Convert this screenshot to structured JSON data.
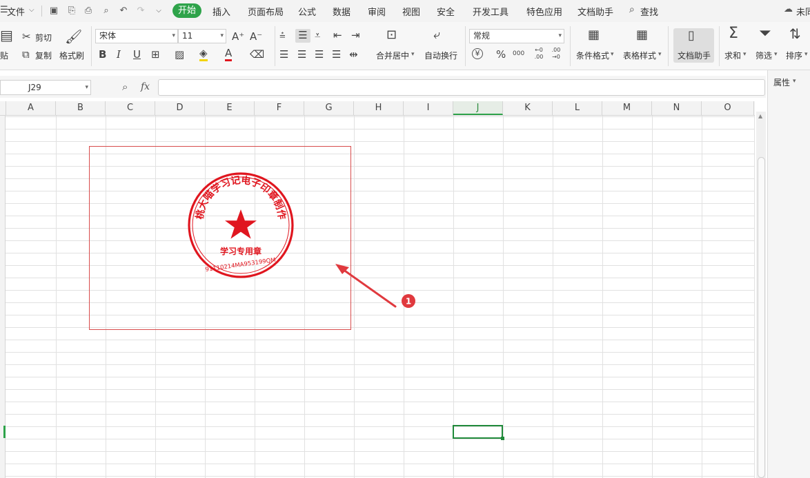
{
  "menu": {
    "file": "文件",
    "tabs": [
      "开始",
      "插入",
      "页面布局",
      "公式",
      "数据",
      "审阅",
      "视图",
      "安全",
      "开发工具",
      "特色应用",
      "文档助手"
    ],
    "search": "查找",
    "cloud": "未同"
  },
  "ribbon": {
    "paste": "贴",
    "cut": "剪切",
    "copy": "复制",
    "format_painter": "格式刷",
    "font_name": "宋体",
    "font_size": "11",
    "grow_font": "A⁺",
    "shrink_font": "A⁻",
    "merge_center": "合并居中",
    "wrap_text": "自动换行",
    "number_format": "常规",
    "currency": "¥",
    "percent": "%",
    "thousands": "000",
    "inc_decimal": "←0 .00",
    "dec_decimal": ".00 →0",
    "cond_format": "条件格式",
    "table_style": "表格样式",
    "doc_helper": "文档助手",
    "sum": "求和",
    "filter": "筛选",
    "sort": "排序"
  },
  "formula_bar": {
    "name_box": "J29",
    "fx": "fx",
    "formula": ""
  },
  "side_panel": {
    "title": "属性"
  },
  "sheet": {
    "columns": [
      "A",
      "B",
      "C",
      "D",
      "E",
      "F",
      "G",
      "H",
      "I",
      "J",
      "K",
      "L",
      "M",
      "N",
      "O"
    ],
    "active_column": "J",
    "selected_cell": "J29"
  },
  "stamp": {
    "arc_text": "桃大喵学习记电子印章制作",
    "center_text": "学习专用章",
    "code_text": "91110214MA953199QM",
    "color": "#e0161f"
  },
  "annotation": {
    "badge": "1",
    "color": "#e0393e"
  }
}
